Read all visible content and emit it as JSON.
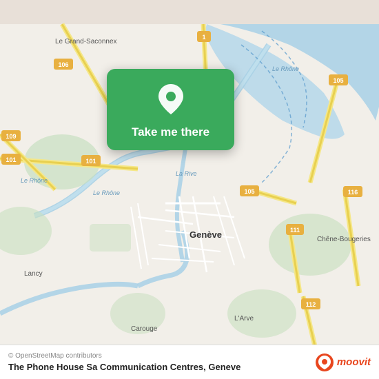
{
  "map": {
    "attribution": "© OpenStreetMap contributors",
    "background_color": "#e8e0d8"
  },
  "action_card": {
    "button_label": "Take me there",
    "background_color": "#3aaa5c",
    "icon": "location-pin-icon"
  },
  "bottom_bar": {
    "venue_name": "The Phone House Sa Communication Centres, Geneve",
    "attribution": "© OpenStreetMap contributors",
    "logo_text": "moovit"
  }
}
